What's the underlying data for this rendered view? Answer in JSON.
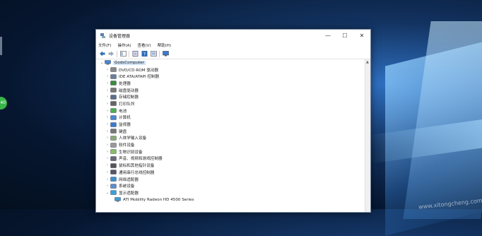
{
  "window": {
    "title": "设备管理器",
    "controls": {
      "minimize": "—",
      "maximize": "☐",
      "close": "✕"
    }
  },
  "menu": [
    "文件(F)",
    "操作(A)",
    "查看(V)",
    "帮助(H)"
  ],
  "toolbar_icons": [
    "back-arrow-icon",
    "forward-arrow-icon",
    "show-hide-tree-icon",
    "properties-icon",
    "help-icon",
    "update-driver-icon",
    "monitor-icon"
  ],
  "tree": {
    "root": {
      "label": "GodsComputer",
      "expander": "⌄"
    },
    "items": [
      {
        "label": "DVD/CD-ROM 驱动器",
        "icon": "dvd-drive-icon",
        "expander": "›"
      },
      {
        "label": "IDE ATA/ATAPI 控制器",
        "icon": "ide-controller-icon",
        "expander": "›"
      },
      {
        "label": "处理器",
        "icon": "processor-icon",
        "expander": "›"
      },
      {
        "label": "磁盘驱动器",
        "icon": "disk-drive-icon",
        "expander": "›"
      },
      {
        "label": "存储控制器",
        "icon": "storage-controller-icon",
        "expander": "›"
      },
      {
        "label": "打印队列",
        "icon": "printer-icon",
        "expander": "›"
      },
      {
        "label": "电池",
        "icon": "battery-icon",
        "expander": "›"
      },
      {
        "label": "计算机",
        "icon": "computer-icon",
        "expander": "›"
      },
      {
        "label": "监视器",
        "icon": "monitor-icon",
        "expander": "›"
      },
      {
        "label": "键盘",
        "icon": "keyboard-icon",
        "expander": "›"
      },
      {
        "label": "人体学输入设备",
        "icon": "hid-icon",
        "expander": "›"
      },
      {
        "label": "软件设备",
        "icon": "software-device-icon",
        "expander": "›"
      },
      {
        "label": "生物识别设备",
        "icon": "biometric-icon",
        "expander": "›"
      },
      {
        "label": "声音、视频和游戏控制器",
        "icon": "sound-icon",
        "expander": "›"
      },
      {
        "label": "鼠标和其他指针设备",
        "icon": "mouse-icon",
        "expander": "›"
      },
      {
        "label": "通用串行总线控制器",
        "icon": "usb-icon",
        "expander": "›"
      },
      {
        "label": "网络适配器",
        "icon": "network-adapter-icon",
        "expander": "›"
      },
      {
        "label": "系统设备",
        "icon": "system-device-icon",
        "expander": "›"
      },
      {
        "label": "显示适配器",
        "icon": "display-adapter-icon",
        "expander": "⌄"
      }
    ],
    "child": {
      "label": "ATI Mobility Radeon HD 4500 Series",
      "icon": "display-adapter-icon"
    }
  },
  "desktop": {
    "badge_text": "40",
    "watermark": "www.xitongcheng.com"
  },
  "colors": {
    "selection": "#cfe2f7",
    "accent": "#1f6fc4"
  }
}
